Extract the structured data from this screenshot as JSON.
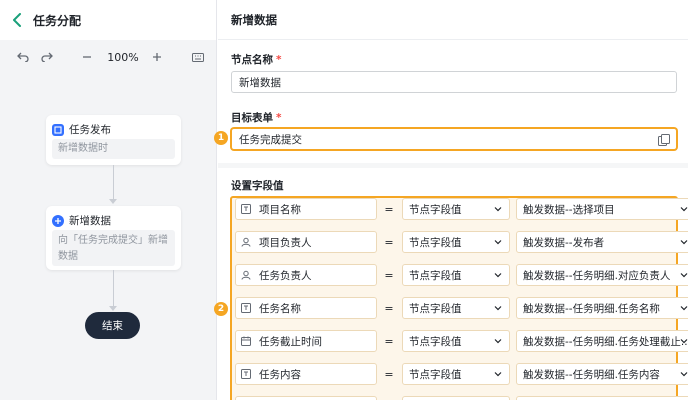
{
  "left": {
    "title": "任务分配",
    "zoom": "100%",
    "nodes": [
      {
        "title": "任务发布",
        "body": "新增数据时"
      },
      {
        "title": "新增数据",
        "body": "向「任务完成提交」新增数据"
      }
    ],
    "end_label": "结束"
  },
  "right": {
    "title": "新增数据",
    "node_name_label": "节点名称",
    "node_name_value": "新增数据",
    "target_form_label": "目标表单",
    "target_form_value": "任务完成提交",
    "fields_label": "设置字段值",
    "badges": [
      "1",
      "2"
    ],
    "rows": [
      {
        "field": "项目名称",
        "icon": "text-field-icon",
        "op": "=",
        "type": "节点字段值",
        "value": "触发数据--选择项目"
      },
      {
        "field": "项目负责人",
        "icon": "person-icon",
        "op": "=",
        "type": "节点字段值",
        "value": "触发数据--发布者"
      },
      {
        "field": "任务负责人",
        "icon": "person-icon",
        "op": "=",
        "type": "节点字段值",
        "value": "触发数据--任务明细.对应负责人"
      },
      {
        "field": "任务名称",
        "icon": "text-field-icon",
        "op": "=",
        "type": "节点字段值",
        "value": "触发数据--任务明细.任务名称"
      },
      {
        "field": "任务截止时间",
        "icon": "calendar-icon",
        "op": "=",
        "type": "节点字段值",
        "value": "触发数据--任务明细.任务处理截止..."
      },
      {
        "field": "任务内容",
        "icon": "text-field-icon",
        "op": "=",
        "type": "节点字段值",
        "value": "触发数据--任务明细.任务内容"
      },
      {
        "field": "",
        "icon": "text-field-icon",
        "op": "",
        "type": "",
        "value": ""
      }
    ]
  },
  "colors": {
    "accent": "#f5a623",
    "primary": "#3370ff",
    "end": "#1f2a3c"
  }
}
